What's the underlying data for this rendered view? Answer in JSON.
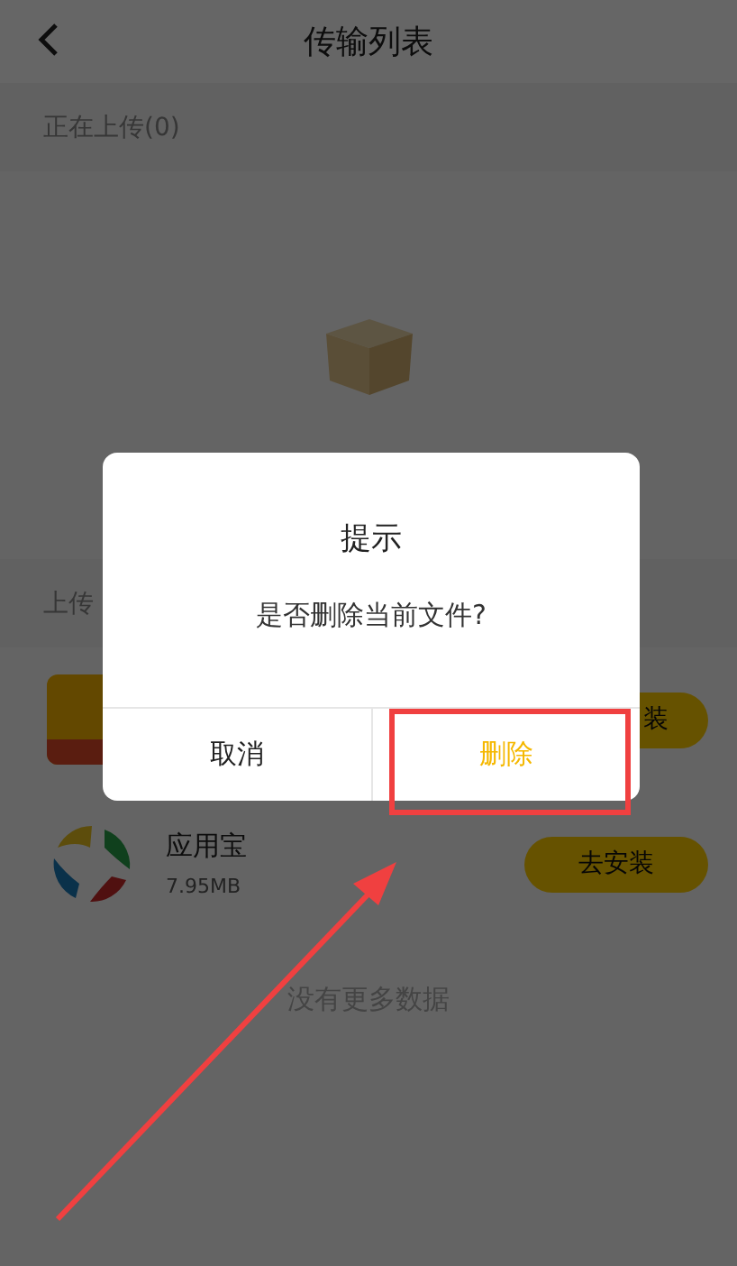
{
  "header": {
    "title": "传输列表"
  },
  "uploading": {
    "label": "正在上传(0)"
  },
  "uploaded": {
    "label": "上传"
  },
  "files": [
    {
      "kind": "partial",
      "button": "装"
    },
    {
      "kind": "app",
      "name": "应用宝",
      "size": "7.95MB",
      "button": "去安装"
    }
  ],
  "footer": "没有更多数据",
  "dialog": {
    "title": "提示",
    "message": "是否删除当前文件?",
    "buttons": [
      {
        "label": "取消",
        "kind": "cancel",
        "annotated": false
      },
      {
        "label": "删除",
        "kind": "confirm",
        "annotated": true
      }
    ]
  }
}
